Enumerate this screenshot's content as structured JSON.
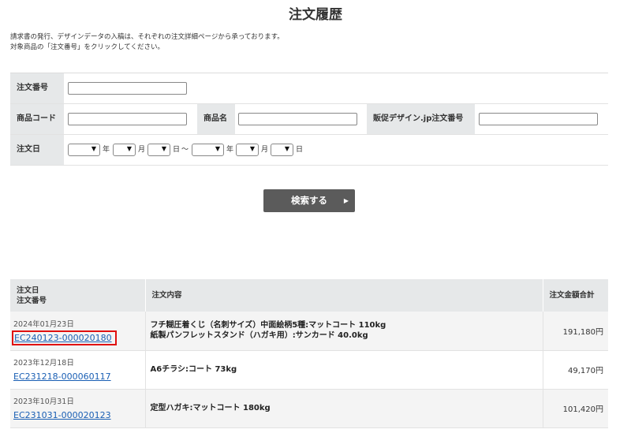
{
  "page": {
    "title": "注文履歴",
    "description": [
      "請求書の発行、デザインデータの入稿は、それぞれの注文詳細ページから承っております。",
      "対象商品の「注文番号」をクリックしてください。"
    ]
  },
  "search": {
    "order_number_label": "注文番号",
    "order_number_value": "",
    "product_code_label": "商品コード",
    "product_code_value": "",
    "product_name_label": "商品名",
    "product_name_value": "",
    "hansoku_order_label": "販促デザイン.jp注文番号",
    "hansoku_order_value": "",
    "order_date_label": "注文日",
    "year_unit": "年",
    "month_unit": "月",
    "day_unit": "日",
    "range_sep": "～",
    "submit_label": "検索する",
    "submit_arrow": "▶"
  },
  "results": {
    "headers": {
      "date_line1": "注文日",
      "date_line2": "注文番号",
      "contents": "注文内容",
      "amount": "注文金額合計"
    },
    "rows": [
      {
        "date": "2024年01月23日",
        "order_no": "EC240123-000020180",
        "contents_line1": "フチ糊圧着くじ（名刺サイズ）中面絵柄5種:マットコート 110kg",
        "contents_line2": "紙製パンフレットスタンド（ハガキ用）:サンカード 40.0kg",
        "amount": "191,180円",
        "highlighted": true
      },
      {
        "date": "2023年12月18日",
        "order_no": "EC231218-000060117",
        "contents_line1": "A6チラシ:コート 73kg",
        "contents_line2": "",
        "amount": "49,170円",
        "highlighted": false
      },
      {
        "date": "2023年10月31日",
        "order_no": "EC231031-000020123",
        "contents_line1": "定型ハガキ:マットコート 180kg",
        "contents_line2": "",
        "amount": "101,420円",
        "highlighted": false
      }
    ]
  },
  "colors": {
    "highlight_border": "#e01010",
    "link": "#1a5fb4",
    "button_bg": "#5b5b5b"
  }
}
